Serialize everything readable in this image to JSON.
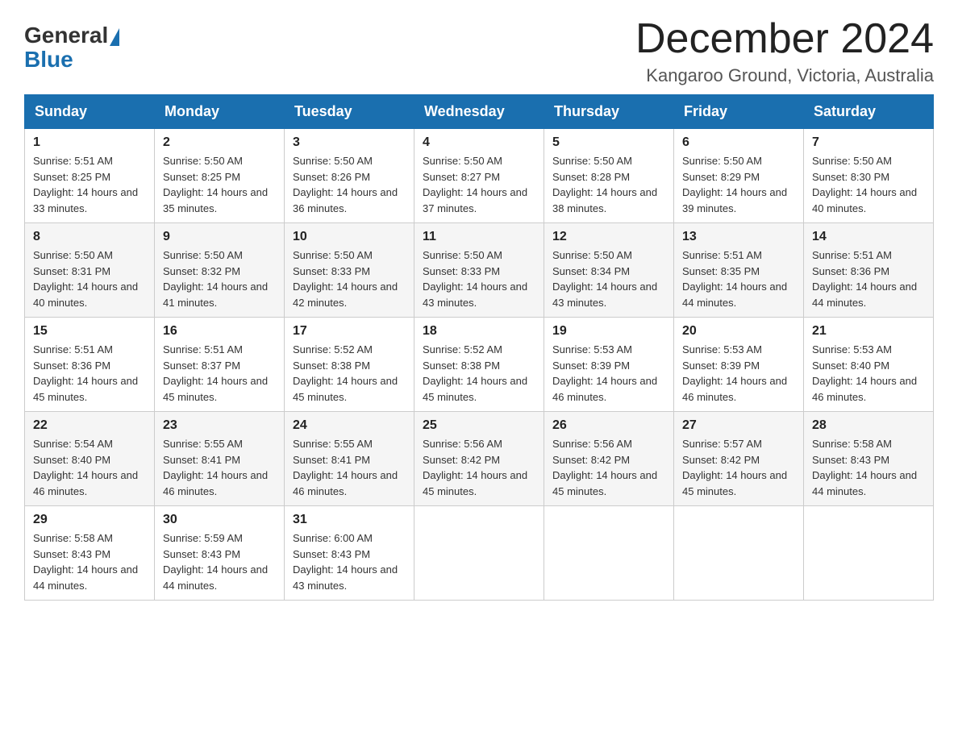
{
  "header": {
    "logo": {
      "general": "General",
      "blue": "Blue"
    },
    "title": "December 2024",
    "location": "Kangaroo Ground, Victoria, Australia"
  },
  "calendar": {
    "days": [
      "Sunday",
      "Monday",
      "Tuesday",
      "Wednesday",
      "Thursday",
      "Friday",
      "Saturday"
    ],
    "weeks": [
      [
        {
          "day": 1,
          "sunrise": "5:51 AM",
          "sunset": "8:25 PM",
          "daylight": "14 hours and 33 minutes."
        },
        {
          "day": 2,
          "sunrise": "5:50 AM",
          "sunset": "8:25 PM",
          "daylight": "14 hours and 35 minutes."
        },
        {
          "day": 3,
          "sunrise": "5:50 AM",
          "sunset": "8:26 PM",
          "daylight": "14 hours and 36 minutes."
        },
        {
          "day": 4,
          "sunrise": "5:50 AM",
          "sunset": "8:27 PM",
          "daylight": "14 hours and 37 minutes."
        },
        {
          "day": 5,
          "sunrise": "5:50 AM",
          "sunset": "8:28 PM",
          "daylight": "14 hours and 38 minutes."
        },
        {
          "day": 6,
          "sunrise": "5:50 AM",
          "sunset": "8:29 PM",
          "daylight": "14 hours and 39 minutes."
        },
        {
          "day": 7,
          "sunrise": "5:50 AM",
          "sunset": "8:30 PM",
          "daylight": "14 hours and 40 minutes."
        }
      ],
      [
        {
          "day": 8,
          "sunrise": "5:50 AM",
          "sunset": "8:31 PM",
          "daylight": "14 hours and 40 minutes."
        },
        {
          "day": 9,
          "sunrise": "5:50 AM",
          "sunset": "8:32 PM",
          "daylight": "14 hours and 41 minutes."
        },
        {
          "day": 10,
          "sunrise": "5:50 AM",
          "sunset": "8:33 PM",
          "daylight": "14 hours and 42 minutes."
        },
        {
          "day": 11,
          "sunrise": "5:50 AM",
          "sunset": "8:33 PM",
          "daylight": "14 hours and 43 minutes."
        },
        {
          "day": 12,
          "sunrise": "5:50 AM",
          "sunset": "8:34 PM",
          "daylight": "14 hours and 43 minutes."
        },
        {
          "day": 13,
          "sunrise": "5:51 AM",
          "sunset": "8:35 PM",
          "daylight": "14 hours and 44 minutes."
        },
        {
          "day": 14,
          "sunrise": "5:51 AM",
          "sunset": "8:36 PM",
          "daylight": "14 hours and 44 minutes."
        }
      ],
      [
        {
          "day": 15,
          "sunrise": "5:51 AM",
          "sunset": "8:36 PM",
          "daylight": "14 hours and 45 minutes."
        },
        {
          "day": 16,
          "sunrise": "5:51 AM",
          "sunset": "8:37 PM",
          "daylight": "14 hours and 45 minutes."
        },
        {
          "day": 17,
          "sunrise": "5:52 AM",
          "sunset": "8:38 PM",
          "daylight": "14 hours and 45 minutes."
        },
        {
          "day": 18,
          "sunrise": "5:52 AM",
          "sunset": "8:38 PM",
          "daylight": "14 hours and 45 minutes."
        },
        {
          "day": 19,
          "sunrise": "5:53 AM",
          "sunset": "8:39 PM",
          "daylight": "14 hours and 46 minutes."
        },
        {
          "day": 20,
          "sunrise": "5:53 AM",
          "sunset": "8:39 PM",
          "daylight": "14 hours and 46 minutes."
        },
        {
          "day": 21,
          "sunrise": "5:53 AM",
          "sunset": "8:40 PM",
          "daylight": "14 hours and 46 minutes."
        }
      ],
      [
        {
          "day": 22,
          "sunrise": "5:54 AM",
          "sunset": "8:40 PM",
          "daylight": "14 hours and 46 minutes."
        },
        {
          "day": 23,
          "sunrise": "5:55 AM",
          "sunset": "8:41 PM",
          "daylight": "14 hours and 46 minutes."
        },
        {
          "day": 24,
          "sunrise": "5:55 AM",
          "sunset": "8:41 PM",
          "daylight": "14 hours and 46 minutes."
        },
        {
          "day": 25,
          "sunrise": "5:56 AM",
          "sunset": "8:42 PM",
          "daylight": "14 hours and 45 minutes."
        },
        {
          "day": 26,
          "sunrise": "5:56 AM",
          "sunset": "8:42 PM",
          "daylight": "14 hours and 45 minutes."
        },
        {
          "day": 27,
          "sunrise": "5:57 AM",
          "sunset": "8:42 PM",
          "daylight": "14 hours and 45 minutes."
        },
        {
          "day": 28,
          "sunrise": "5:58 AM",
          "sunset": "8:43 PM",
          "daylight": "14 hours and 44 minutes."
        }
      ],
      [
        {
          "day": 29,
          "sunrise": "5:58 AM",
          "sunset": "8:43 PM",
          "daylight": "14 hours and 44 minutes."
        },
        {
          "day": 30,
          "sunrise": "5:59 AM",
          "sunset": "8:43 PM",
          "daylight": "14 hours and 44 minutes."
        },
        {
          "day": 31,
          "sunrise": "6:00 AM",
          "sunset": "8:43 PM",
          "daylight": "14 hours and 43 minutes."
        },
        null,
        null,
        null,
        null
      ]
    ]
  }
}
